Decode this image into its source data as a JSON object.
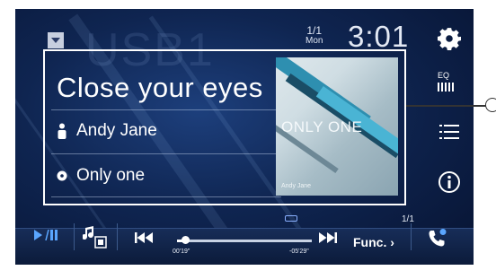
{
  "status": {
    "date_line1": "1/1",
    "date_line2": "Mon",
    "time": "3:01"
  },
  "background": {
    "source_label": "USB1"
  },
  "side": {
    "eq_label": "EQ"
  },
  "track": {
    "title": "Close your eyes",
    "artist": "Andy Jane",
    "album": "Only one",
    "cover_text": "ONLY ONE",
    "cover_artist": "Andy Jane"
  },
  "page": {
    "indicator": "1/1"
  },
  "transport": {
    "elapsed": "00'19\"",
    "remaining": "-05'29\"",
    "func_label": "Func.",
    "progress_fraction": 0.06
  },
  "colors": {
    "accent": "#5aa6ff",
    "background": "#0f2551"
  },
  "icons": [
    "source-dropdown-icon",
    "gear-icon",
    "eq-icon",
    "list-icon",
    "info-icon",
    "play-pause-icon",
    "music-source-icon",
    "prev-track-icon",
    "next-track-icon",
    "phone-icon",
    "person-icon",
    "disc-icon"
  ]
}
